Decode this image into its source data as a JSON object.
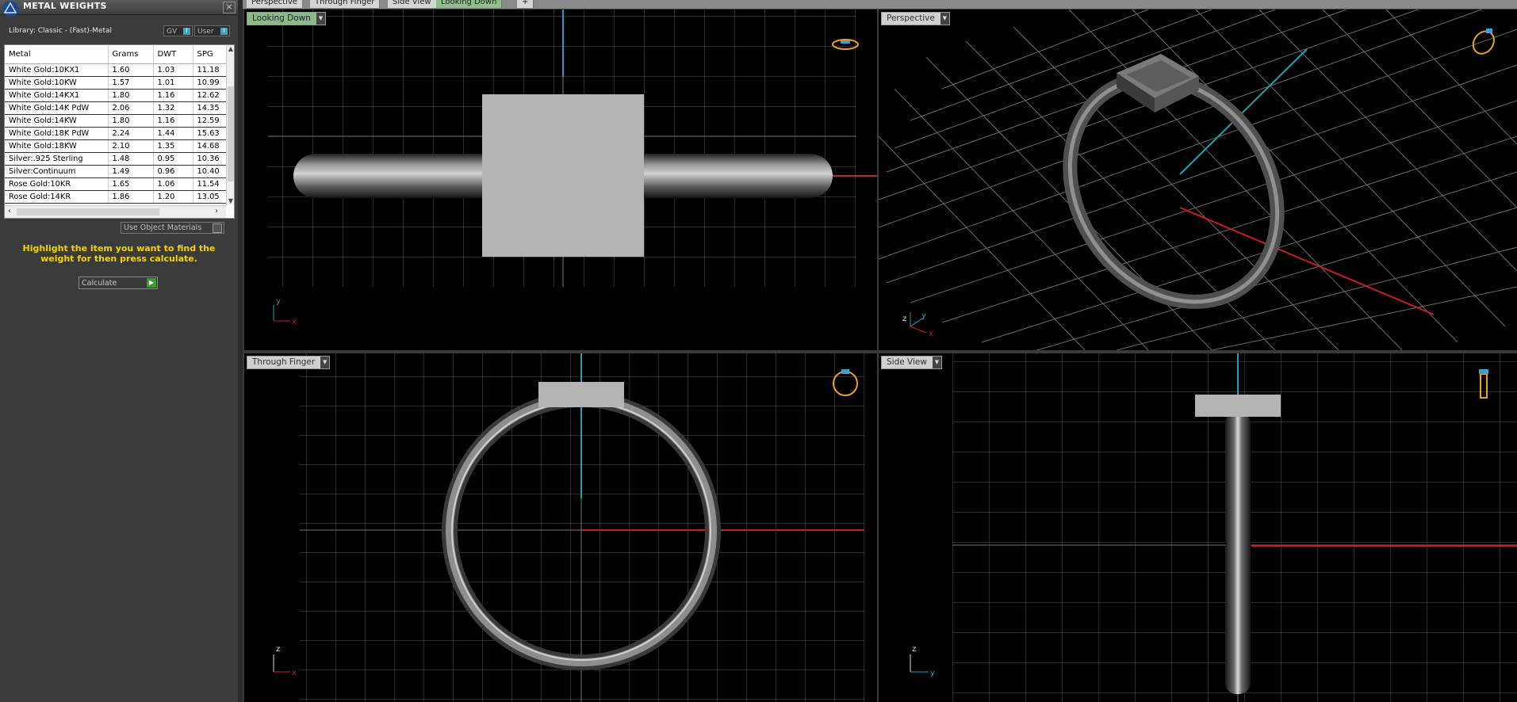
{
  "panel": {
    "title": "METAL WEIGHTS",
    "library": "Library: Classic - (Fast)-Metal",
    "toggle_gv": "GV",
    "toggle_user": "User",
    "toggle_info": "i",
    "columns": [
      "Metal",
      "Grams",
      "DWT",
      "SPG"
    ],
    "rows": [
      [
        "White Gold:10KX1",
        "1.60",
        "1.03",
        "11.18"
      ],
      [
        "White Gold:10KW",
        "1.57",
        "1.01",
        "10.99"
      ],
      [
        "White Gold:14KX1",
        "1.80",
        "1.16",
        "12.62"
      ],
      [
        "White Gold:14K PdW",
        "2.06",
        "1.32",
        "14.35"
      ],
      [
        "White Gold:14KW",
        "1.80",
        "1.16",
        "12.59"
      ],
      [
        "White Gold:18K PdW",
        "2.24",
        "1.44",
        "15.63"
      ],
      [
        "White Gold:18KW",
        "2.10",
        "1.35",
        "14.68"
      ],
      [
        "Silver:.925 Sterling",
        "1.48",
        "0.95",
        "10.36"
      ],
      [
        "Silver:Continuum",
        "1.49",
        "0.96",
        "10.40"
      ],
      [
        "Rose Gold:10KR",
        "1.65",
        "1.06",
        "11.54"
      ],
      [
        "Rose Gold:14KR",
        "1.86",
        "1.20",
        "13.05"
      ]
    ],
    "use_object_materials": "Use Object Materials",
    "hint": "Highlight the item you want to find the weight for then press calculate.",
    "calculate_label": "Calculate"
  },
  "tabs": [
    {
      "label": "Perspective",
      "active": false
    },
    {
      "label": "Through Finger",
      "active": false
    },
    {
      "label": "Side View",
      "active": false
    },
    {
      "label": "Looking Down",
      "active": true
    },
    {
      "label": "+",
      "active": false
    }
  ],
  "viewports": {
    "top_left": {
      "label": "Looking Down",
      "axis1": "y",
      "axis2": "x"
    },
    "top_right": {
      "label": "Perspective",
      "axis1": "z",
      "axis2": "y",
      "axis3": "x"
    },
    "bottom_left": {
      "label": "Through Finger",
      "axis1": "z",
      "axis2": "x"
    },
    "bottom_right": {
      "label": "Side View",
      "axis1": "z",
      "axis2": "y"
    }
  },
  "colors": {
    "grid": "#3a3a3a",
    "grid_major": "#7a7a7a",
    "axis_x": "#c81e1e",
    "axis_y": "#1fa0b8",
    "ring_icon": "#f0a020"
  }
}
